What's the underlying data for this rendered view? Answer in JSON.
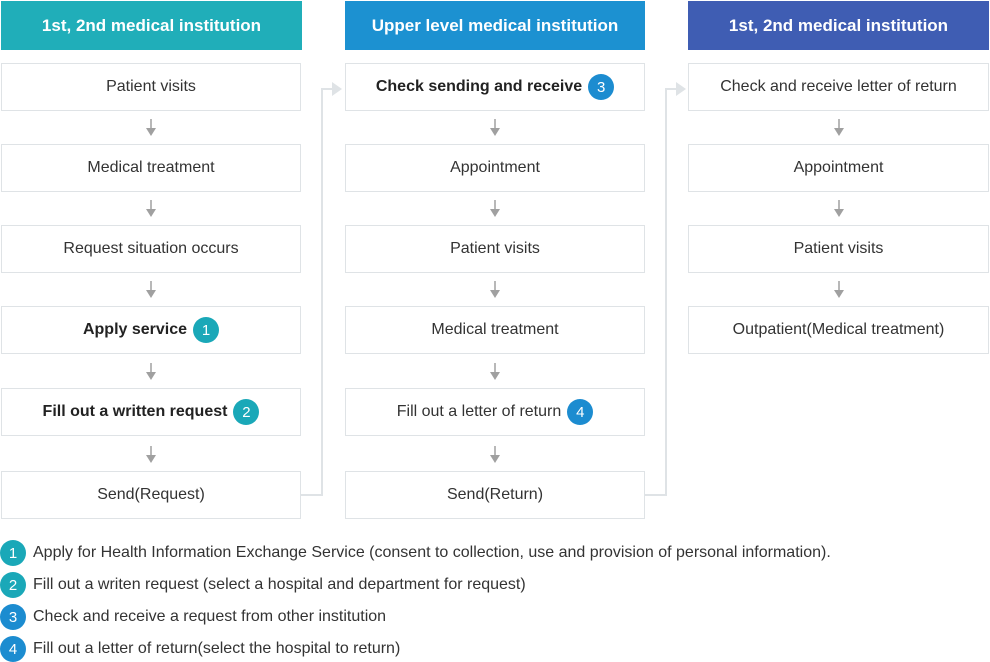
{
  "columns": [
    {
      "title": "1st, 2nd medical institution",
      "color": "#20aeb9",
      "steps": [
        {
          "label": "Patient visits",
          "bold": false
        },
        {
          "label": "Medical treatment",
          "bold": false
        },
        {
          "label": "Request situation occurs",
          "bold": false
        },
        {
          "label": "Apply service",
          "bold": true,
          "badge": "1"
        },
        {
          "label": "Fill out a written request",
          "bold": true,
          "badge": "2"
        },
        {
          "label": "Send(Request)",
          "bold": false
        }
      ]
    },
    {
      "title": "Upper level medical institution",
      "color": "#1c91d1",
      "steps": [
        {
          "label": "Check sending and receive",
          "bold": true,
          "badge": "3"
        },
        {
          "label": "Appointment",
          "bold": false
        },
        {
          "label": "Patient visits",
          "bold": false
        },
        {
          "label": "Medical treatment",
          "bold": false
        },
        {
          "label": "Fill out a letter of return",
          "bold": false,
          "badge": "4"
        },
        {
          "label": "Send(Return)",
          "bold": false
        }
      ]
    },
    {
      "title": "1st, 2nd medical institution",
      "color": "#3f5db3",
      "steps": [
        {
          "label": "Check and receive letter of return",
          "bold": false
        },
        {
          "label": "Appointment",
          "bold": false
        },
        {
          "label": "Patient visits",
          "bold": false
        },
        {
          "label": "Outpatient(Medical treatment)",
          "bold": false
        }
      ]
    }
  ],
  "legend": [
    {
      "num": "1",
      "text": "Apply for Health Information Exchange Service (consent to collection, use and provision of personal information).",
      "color": "teal"
    },
    {
      "num": "2",
      "text": "Fill out a writen request (select a hospital and department for request)",
      "color": "teal"
    },
    {
      "num": "3",
      "text": "Check and receive a request from other institution",
      "color": "blue"
    },
    {
      "num": "4",
      "text": "Fill out a letter of return(select the hospital to return)",
      "color": "blue"
    }
  ],
  "colors": {
    "badge_teal": "#1aa8b8",
    "badge_blue": "#1c8cd0",
    "arrow": "#a0a0a0",
    "connector": "#dfe3e6"
  }
}
